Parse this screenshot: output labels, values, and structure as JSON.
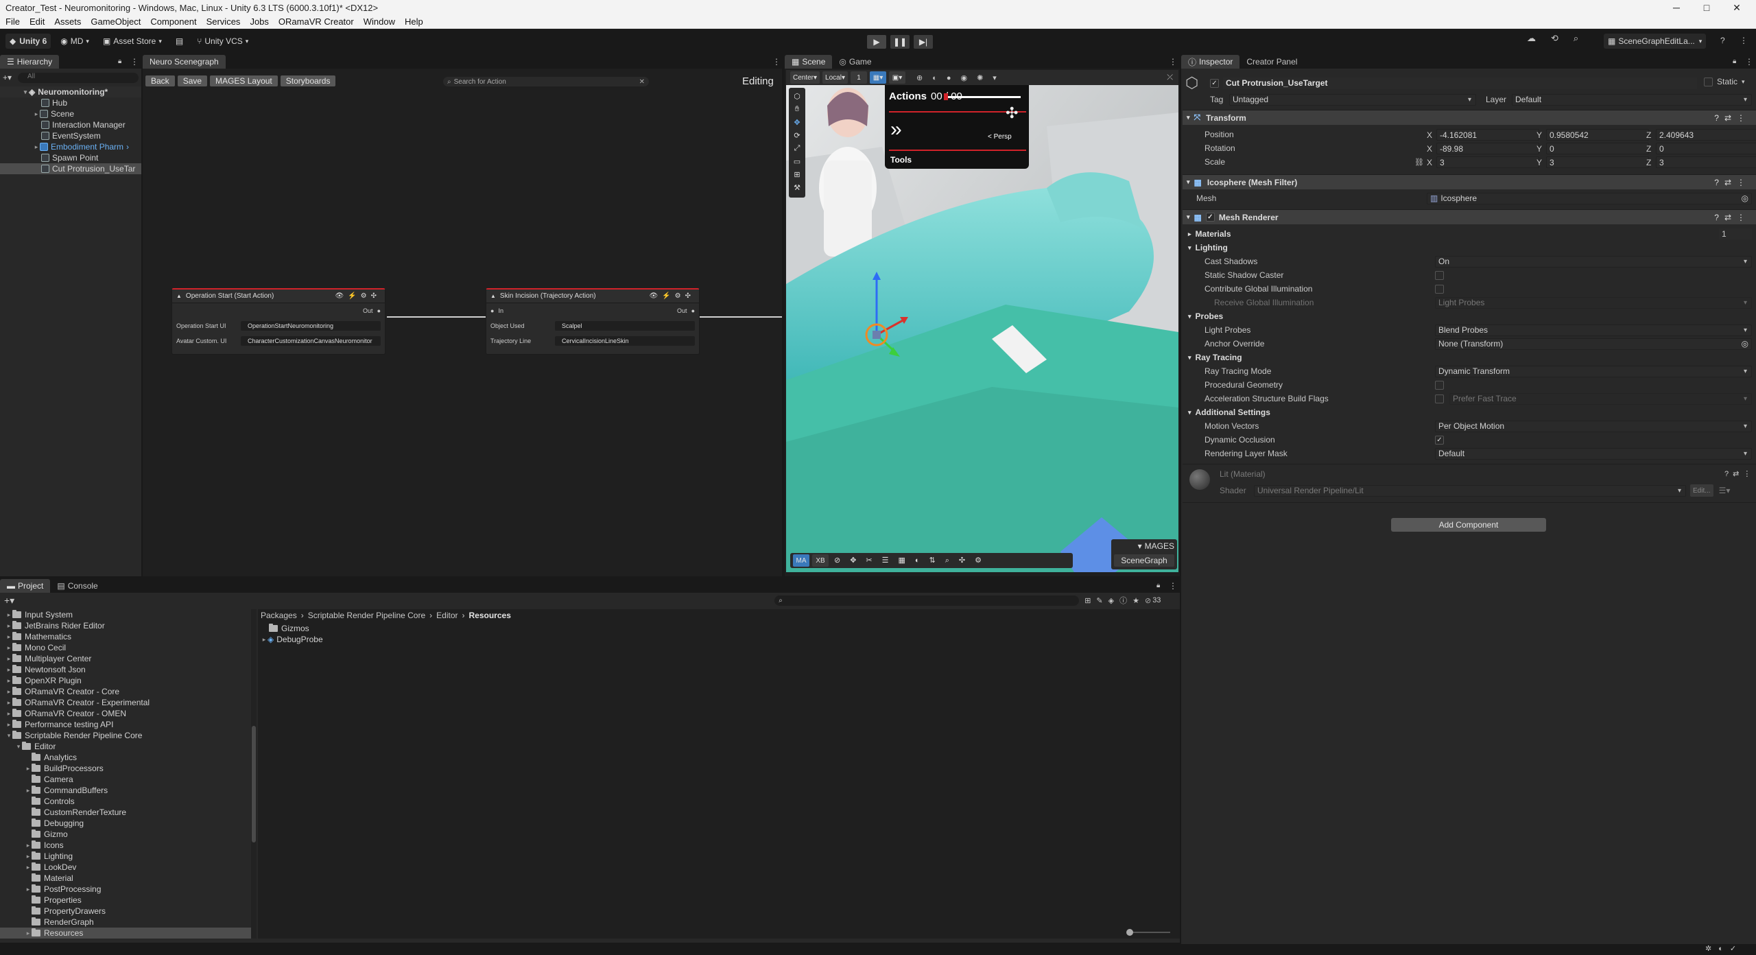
{
  "window": {
    "title": "Creator_Test - Neuromonitoring - Windows, Mac, Linux - Unity 6.3 LTS (6000.3.10f1)* <DX12>"
  },
  "menu": [
    "File",
    "Edit",
    "Assets",
    "GameObject",
    "Component",
    "Services",
    "Jobs",
    "ORamaVR Creator",
    "Window",
    "Help"
  ],
  "toolbar": {
    "unity": "Unity 6",
    "account": "MD",
    "asset_store": "Asset Store",
    "vcs": "Unity VCS",
    "layout": "SceneGraphEditLa..."
  },
  "hierarchy": {
    "tab": "Hierarchy",
    "search_placeholder": "All",
    "root": "Neuromonitoring*",
    "items": [
      "Hub",
      "Scene",
      "Interaction Manager",
      "EventSystem",
      "Embodiment Pharm",
      "Spawn Point",
      "Cut Protrusion_UseTar"
    ]
  },
  "scenegraph": {
    "tab": "Neuro Scenegraph",
    "buttons": [
      "Back",
      "Save",
      "MAGES Layout",
      "Storyboards"
    ],
    "search_placeholder": "Search for Action",
    "mode": "Editing",
    "node1": {
      "title": "Operation Start (Start Action)",
      "out": "Out",
      "rows": [
        {
          "label": "Operation Start UI",
          "value": "OperationStartNeuromonitoring"
        },
        {
          "label": "Avatar Custom. UI",
          "value": "CharacterCustomizationCanvasNeuromonitor"
        }
      ]
    },
    "node2": {
      "title": "Skin Incision (Trajectory Action)",
      "in": "In",
      "out": "Out",
      "rows": [
        {
          "label": "Object Used",
          "value": "Scalpel"
        },
        {
          "label": "Trajectory Line",
          "value": "CervicalIncisionLineSkin"
        }
      ]
    }
  },
  "scene": {
    "tabs": [
      "Scene",
      "Game"
    ],
    "pivot": "Center",
    "space": "Local",
    "snap": "1",
    "hud_actions": "Actions",
    "hud_count": "00 / 00",
    "hud_tools": "Tools",
    "persp": "< Persp",
    "mages": "MAGES",
    "scenegraph_btn": "SceneGraph",
    "bottom_buttons": [
      "MA",
      "XB"
    ]
  },
  "inspector": {
    "tabs": [
      "Inspector",
      "Creator Panel"
    ],
    "object_name": "Cut Protrusion_UseTarget",
    "static": "Static",
    "tag_label": "Tag",
    "tag": "Untagged",
    "layer_label": "Layer",
    "layer": "Default",
    "transform": {
      "title": "Transform",
      "position_label": "Position",
      "position": [
        "-4.162081",
        "0.9580542",
        "2.409643"
      ],
      "rotation_label": "Rotation",
      "rotation": [
        "-89.98",
        "0",
        "0"
      ],
      "scale_label": "Scale",
      "scale": [
        "3",
        "3",
        "3"
      ]
    },
    "meshfilter": {
      "title": "Icosphere (Mesh Filter)",
      "mesh_label": "Mesh",
      "mesh": "Icosphere"
    },
    "meshrenderer": {
      "title": "Mesh Renderer",
      "materials": "Materials",
      "materials_count": "1",
      "lighting": "Lighting",
      "cast_shadows_label": "Cast Shadows",
      "cast_shadows": "On",
      "static_shadow": "Static Shadow Caster",
      "contribute_gi": "Contribute Global Illumination",
      "receive_gi": "Receive Global Illumination",
      "receive_gi_value": "Light Probes",
      "probes": "Probes",
      "light_probes_label": "Light Probes",
      "light_probes": "Blend Probes",
      "anchor_label": "Anchor Override",
      "anchor": "None (Transform)",
      "ray_tracing": "Ray Tracing",
      "rt_mode_label": "Ray Tracing Mode",
      "rt_mode": "Dynamic Transform",
      "procedural": "Procedural Geometry",
      "accel_label": "Acceleration Structure Build Flags",
      "accel": "Prefer Fast Trace",
      "additional": "Additional Settings",
      "motion_label": "Motion Vectors",
      "motion": "Per Object Motion",
      "occlusion_label": "Dynamic Occlusion",
      "layer_mask_label": "Rendering Layer Mask",
      "layer_mask": "Default"
    },
    "material": {
      "title": "Lit (Material)",
      "shader_label": "Shader",
      "shader": "Universal Render Pipeline/Lit",
      "edit": "Edit..."
    },
    "add_component": "Add Component"
  },
  "project": {
    "tabs": [
      "Project",
      "Console"
    ],
    "count": "33",
    "tree": [
      {
        "label": "Input System",
        "indent": 1,
        "fold": "▸"
      },
      {
        "label": "JetBrains Rider Editor",
        "indent": 1,
        "fold": "▸"
      },
      {
        "label": "Mathematics",
        "indent": 1,
        "fold": "▸"
      },
      {
        "label": "Mono Cecil",
        "indent": 1,
        "fold": "▸"
      },
      {
        "label": "Multiplayer Center",
        "indent": 1,
        "fold": "▸"
      },
      {
        "label": "Newtonsoft Json",
        "indent": 1,
        "fold": "▸"
      },
      {
        "label": "OpenXR Plugin",
        "indent": 1,
        "fold": "▸"
      },
      {
        "label": "ORamaVR Creator - Core",
        "indent": 1,
        "fold": "▸"
      },
      {
        "label": "ORamaVR Creator - Experimental",
        "indent": 1,
        "fold": "▸"
      },
      {
        "label": "ORamaVR Creator - OMEN",
        "indent": 1,
        "fold": "▸"
      },
      {
        "label": "Performance testing API",
        "indent": 1,
        "fold": "▸"
      },
      {
        "label": "Scriptable Render Pipeline Core",
        "indent": 1,
        "fold": "▾"
      },
      {
        "label": "Editor",
        "indent": 2,
        "fold": "▾"
      },
      {
        "label": "Analytics",
        "indent": 3,
        "fold": ""
      },
      {
        "label": "BuildProcessors",
        "indent": 3,
        "fold": "▸"
      },
      {
        "label": "Camera",
        "indent": 3,
        "fold": ""
      },
      {
        "label": "CommandBuffers",
        "indent": 3,
        "fold": "▸"
      },
      {
        "label": "Controls",
        "indent": 3,
        "fold": ""
      },
      {
        "label": "CustomRenderTexture",
        "indent": 3,
        "fold": ""
      },
      {
        "label": "Debugging",
        "indent": 3,
        "fold": ""
      },
      {
        "label": "Gizmo",
        "indent": 3,
        "fold": ""
      },
      {
        "label": "Icons",
        "indent": 3,
        "fold": "▸"
      },
      {
        "label": "Lighting",
        "indent": 3,
        "fold": "▸"
      },
      {
        "label": "LookDev",
        "indent": 3,
        "fold": "▸"
      },
      {
        "label": "Material",
        "indent": 3,
        "fold": ""
      },
      {
        "label": "PostProcessing",
        "indent": 3,
        "fold": "▸"
      },
      {
        "label": "Properties",
        "indent": 3,
        "fold": ""
      },
      {
        "label": "PropertyDrawers",
        "indent": 3,
        "fold": ""
      },
      {
        "label": "RenderGraph",
        "indent": 3,
        "fold": ""
      },
      {
        "label": "Resources",
        "indent": 3,
        "fold": "▸"
      }
    ],
    "breadcrumb": [
      "Packages",
      "Scriptable Render Pipeline Core",
      "Editor",
      "Resources"
    ],
    "files": [
      "Gizmos",
      "DebugProbe"
    ]
  },
  "colors": {
    "accent_blue": "#3a79bb",
    "red_line": "#d2232a",
    "hierarchy_blue": "#6ab0f3"
  }
}
